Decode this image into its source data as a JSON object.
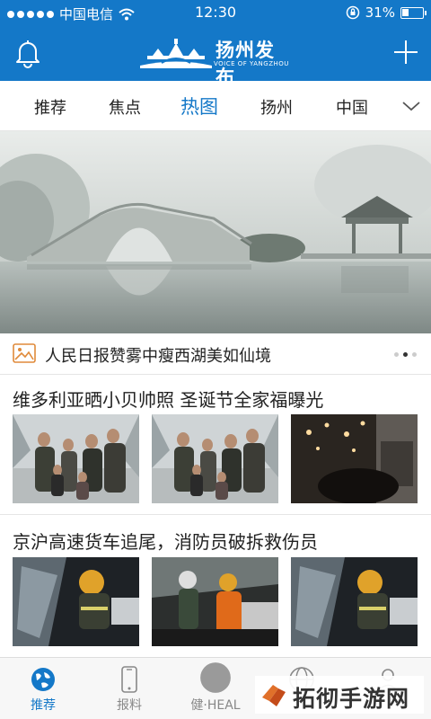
{
  "status": {
    "carrier": "中国电信",
    "time": "12:30",
    "battery": "31%",
    "battery_level": 0.31
  },
  "header": {
    "title": "扬州发布",
    "subtitle": "VOICE OF YANGZHOU"
  },
  "tabs": [
    {
      "label": "推荐"
    },
    {
      "label": "焦点"
    },
    {
      "label": "热图",
      "active": true
    },
    {
      "label": "扬州"
    },
    {
      "label": "中国"
    }
  ],
  "hero": {
    "caption": "人民日报赞雾中瘦西湖美如仙境",
    "page_count": 3,
    "current_page": 2
  },
  "articles": [
    {
      "title": "维多利亚晒小贝帅照 圣诞节全家福曝光"
    },
    {
      "title": "京沪高速货车追尾，消防员破拆救伤员"
    }
  ],
  "bottom_nav": [
    {
      "label": "推荐",
      "icon": "globe-icon",
      "active": true
    },
    {
      "label": "报料",
      "icon": "phone-icon"
    },
    {
      "label": "健·HEAL",
      "icon": "health-circle-icon"
    },
    {
      "label": "",
      "icon": "world-icon"
    },
    {
      "label": "",
      "icon": "user-icon"
    }
  ],
  "watermark": "拓彻手游网",
  "colors": {
    "brand": "#1478c8",
    "inactive": "#888888"
  }
}
